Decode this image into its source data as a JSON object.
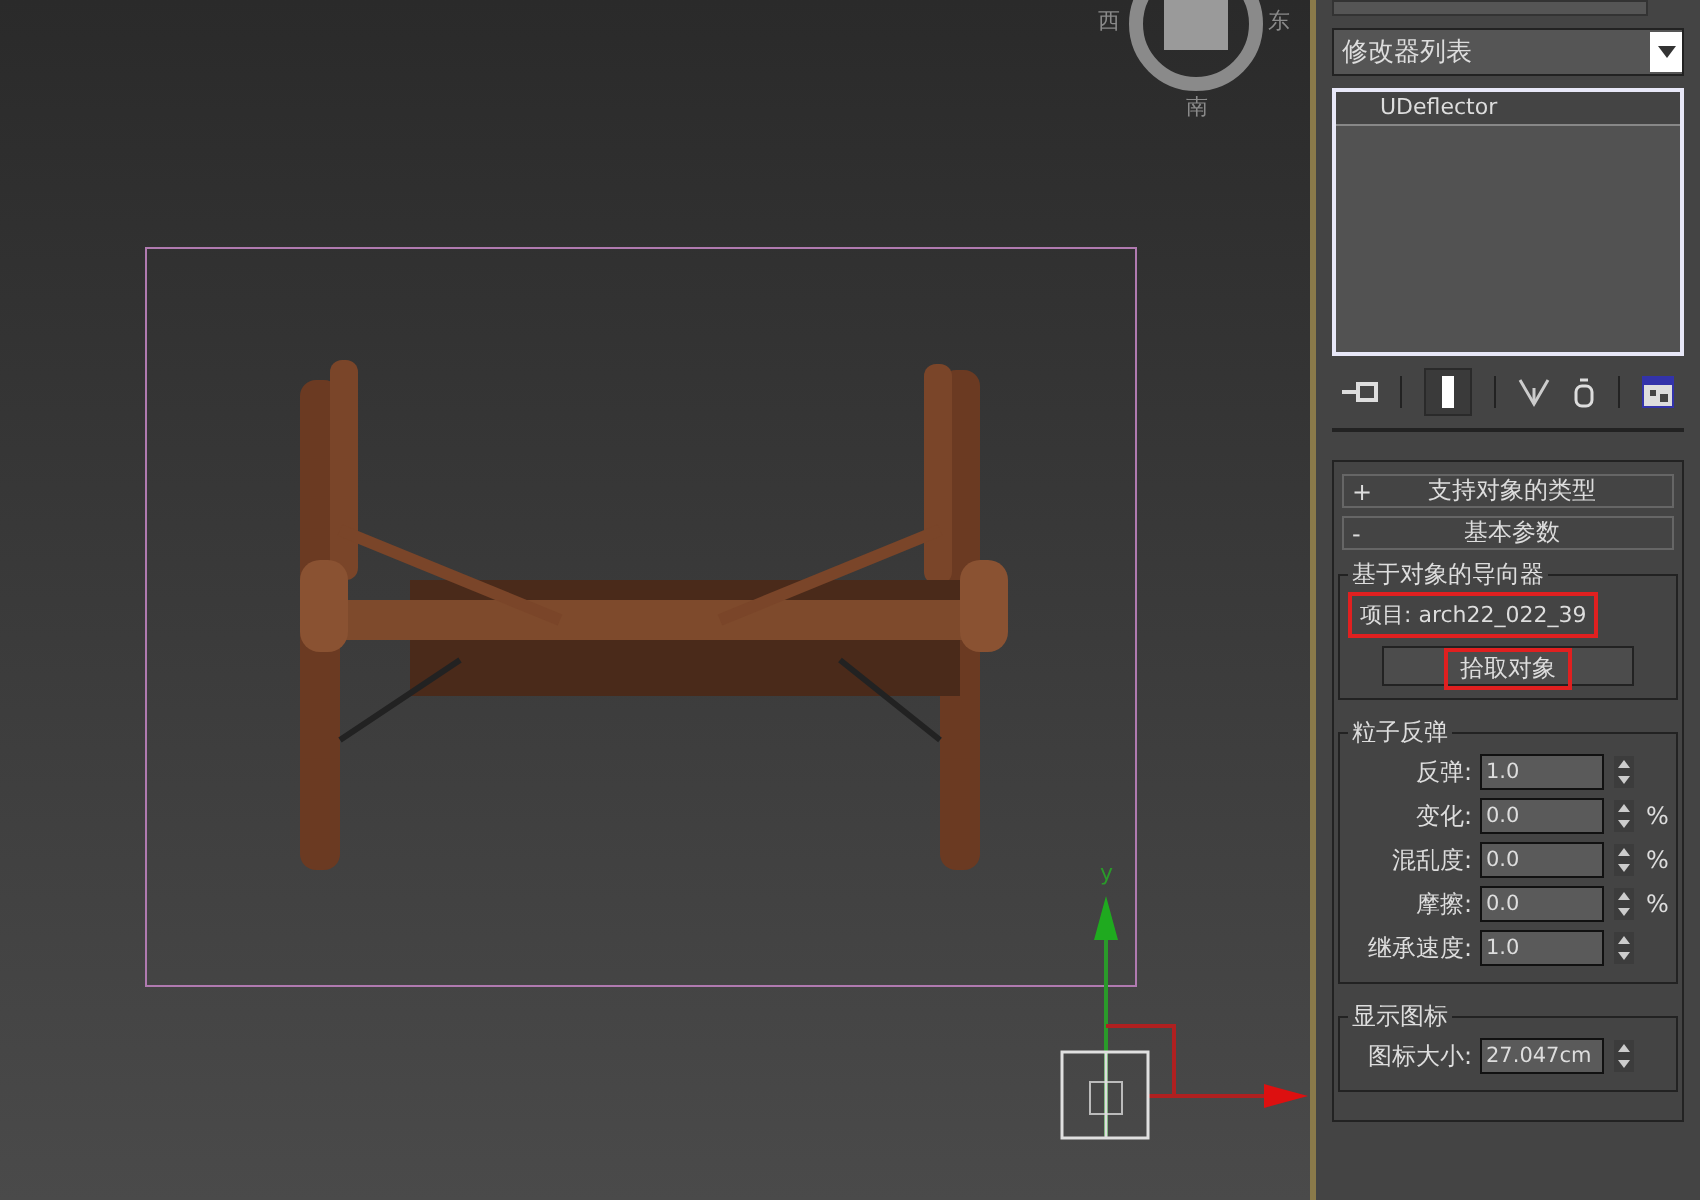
{
  "viewport": {
    "compass_labels": [
      "西",
      "东",
      "南"
    ],
    "gizmo_axis_label": "y"
  },
  "command_panel": {
    "modifier_list": {
      "label": "修改器列表"
    },
    "modifier_stack": [
      {
        "label": "UDeflector",
        "selected": true
      }
    ],
    "rollouts": [
      {
        "sign": "+",
        "title": "支持对象的类型"
      },
      {
        "sign": "-",
        "title": "基本参数"
      }
    ],
    "object_deflector": {
      "title": "基于对象的导向器",
      "item_label": "项目: arch22_022_39",
      "item_highlighted": true,
      "pick_button": "拾取对象",
      "pick_highlighted": true
    },
    "particle_bounce": {
      "title": "粒子反弹",
      "fields": [
        {
          "label": "反弹:",
          "value": "1.0"
        },
        {
          "label": "变化:",
          "value": "0.0",
          "unit": "%"
        },
        {
          "label": "混乱度:",
          "value": "0.0",
          "unit": "%"
        },
        {
          "label": "摩擦:",
          "value": "0.0",
          "unit": "%"
        },
        {
          "label": "继承速度:",
          "value": "1.0"
        }
      ]
    },
    "display_icon": {
      "title": "显示图标",
      "fields": [
        {
          "label": "图标大小:",
          "value": "27.047cm"
        }
      ]
    }
  }
}
